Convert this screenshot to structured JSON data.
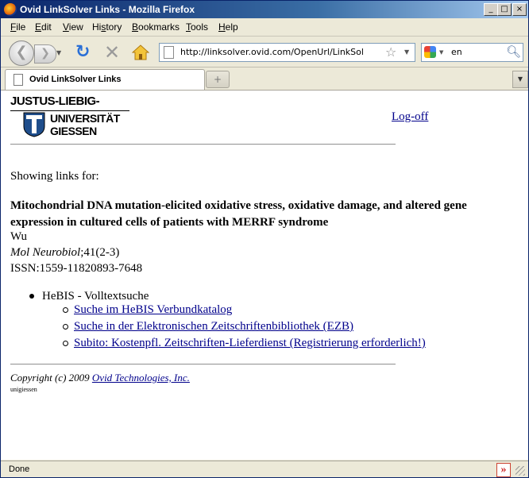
{
  "window": {
    "title": "Ovid LinkSolver Links - Mozilla Firefox",
    "controls": {
      "minimize": "_",
      "maximize": "□",
      "close": "×"
    }
  },
  "menu": {
    "items": [
      {
        "label": "File",
        "accel": "F"
      },
      {
        "label": "Edit",
        "accel": "E"
      },
      {
        "label": "View",
        "accel": "V"
      },
      {
        "label": "History",
        "accel": "s"
      },
      {
        "label": "Bookmarks",
        "accel": "B"
      },
      {
        "label": "Tools",
        "accel": "T"
      },
      {
        "label": "Help",
        "accel": "H"
      }
    ]
  },
  "toolbar": {
    "url": "http://linksolver.ovid.com/OpenUrl/LinkSolver?sid=I:",
    "search_engine_icon": "google-icon",
    "search_value": "en"
  },
  "tabs": {
    "active": "Ovid LinkSolver Links",
    "new_tab_glyph": "+"
  },
  "page": {
    "logo": {
      "line1": "JUSTUS-LIEBIG-",
      "line2": "UNIVERSITÄT",
      "line3": "GIESSEN"
    },
    "logoff": "Log-off",
    "showing": "Showing links for:",
    "article_title": "Mitochondrial DNA mutation-elicited oxidative stress, oxidative damage, and altered gene expression in cultured cells of patients with MERRF syndrome",
    "author": "Wu",
    "journal": "Mol Neurobiol",
    "citation": ";41(2-3)",
    "issn": "ISSN:1559-11820893-7648",
    "group": "HeBIS - Volltextsuche",
    "links": [
      "Suche im HeBIS Verbundkatalog",
      "Suche in der Elektronischen Zeitschriftenbibliothek (EZB)",
      "Subito: Kostenpfl. Zeitschriften-Lieferdienst (Registrierung erforderlich!)"
    ],
    "copyright_prefix": "Copyright (c) 2009 ",
    "copyright_link": "Ovid Technologies, Inc.",
    "footer_small": "unigiessen"
  },
  "status": {
    "text": "Done",
    "addon_glyph": "»"
  },
  "colors": {
    "link": "#00008b",
    "titlebar_start": "#0a246a",
    "chrome": "#ece9d8"
  }
}
